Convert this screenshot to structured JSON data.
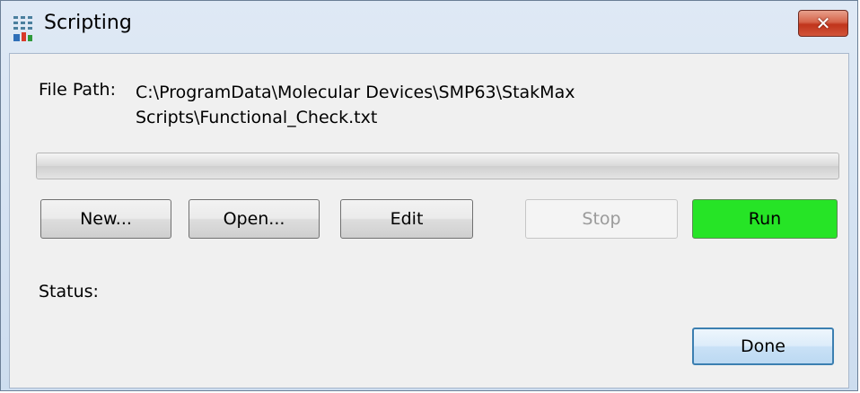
{
  "window": {
    "title": "Scripting",
    "close_label": "✕"
  },
  "file_path": {
    "label": "File Path:",
    "line1": "C:\\ProgramData\\Molecular Devices\\SMP63\\StakMax",
    "line2": "Scripts\\Functional_Check.txt"
  },
  "progress": {
    "value": 0
  },
  "buttons": {
    "new": "New...",
    "open": "Open...",
    "edit": "Edit",
    "stop": "Stop",
    "run": "Run",
    "done": "Done"
  },
  "status": {
    "label": "Status:",
    "value": ""
  },
  "colors": {
    "run_button": "#26e426",
    "close_button": "#c9452c"
  },
  "icons": {
    "title": "scripting-app-icon",
    "close": "close-icon"
  }
}
